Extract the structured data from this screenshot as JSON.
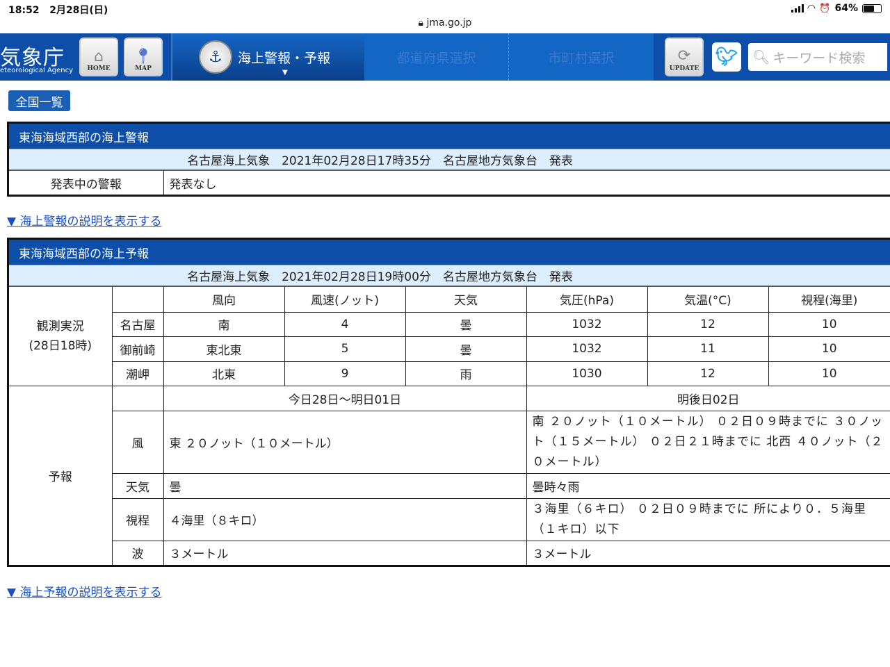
{
  "status_bar": {
    "time": "18:52",
    "date": "2月28日(日)",
    "url": "jma.go.jp",
    "battery": "64%",
    "battery_level": 0.64
  },
  "header": {
    "logo_jp": "気象庁",
    "logo_en": "eteorological Agency",
    "home_label": "HOME",
    "map_label": "MAP",
    "nav_active": "海上警報・予報",
    "nav_prefecture": "都道府県選択",
    "nav_city": "市町村選択",
    "update_label": "UPDATE",
    "search_placeholder": "キーワード検索"
  },
  "all_list_button": "全国一覧",
  "warning": {
    "title": "東海海域西部の海上警報",
    "issued": "名古屋海上気象　2021年02月28日17時35分　名古屋地方気象台　発表",
    "label": "発表中の警報",
    "value": "発表なし",
    "link": "▼ 海上警報の説明を表示する"
  },
  "forecast": {
    "title": "東海海域西部の海上予報",
    "issued": "名古屋海上気象　2021年02月28日19時00分　名古屋地方気象台　発表",
    "obs_label": "観測実況",
    "obs_time": "(28日18時)",
    "obs_headers": [
      "風向",
      "風速(ノット)",
      "天気",
      "気圧(hPa)",
      "気温(°C)",
      "視程(海里)"
    ],
    "obs_rows": [
      {
        "place": "名古屋",
        "dir": "南",
        "speed": "4",
        "weather": "曇",
        "pressure": "1032",
        "temp": "12",
        "vis": "10"
      },
      {
        "place": "御前崎",
        "dir": "東北東",
        "speed": "5",
        "weather": "曇",
        "pressure": "1032",
        "temp": "11",
        "vis": "10"
      },
      {
        "place": "潮岬",
        "dir": "北東",
        "speed": "9",
        "weather": "雨",
        "pressure": "1030",
        "temp": "12",
        "vis": "10"
      }
    ],
    "fc_label": "予報",
    "fc_period1": "今日28日〜明日01日",
    "fc_period2": "明後日02日",
    "rows": {
      "wind": {
        "label": "風",
        "p1": "東 ２０ノット（１０メートル）",
        "p2": "南 ２０ノット（１０メートル） ０２日０９時までに ３０ノット（１５メートル） ０２日２１時までに 北西 ４０ノット（２０メートル）"
      },
      "weather": {
        "label": "天気",
        "p1": "曇",
        "p2": "曇時々雨"
      },
      "visibility": {
        "label": "視程",
        "p1": "４海里（８キロ）",
        "p2": "３海里（６キロ） ０２日０９時までに 所により０．５海里（１キロ）以下"
      },
      "wave": {
        "label": "波",
        "p1": "３メートル",
        "p2": "３メートル"
      }
    },
    "link": "▼ 海上予報の説明を表示する"
  }
}
